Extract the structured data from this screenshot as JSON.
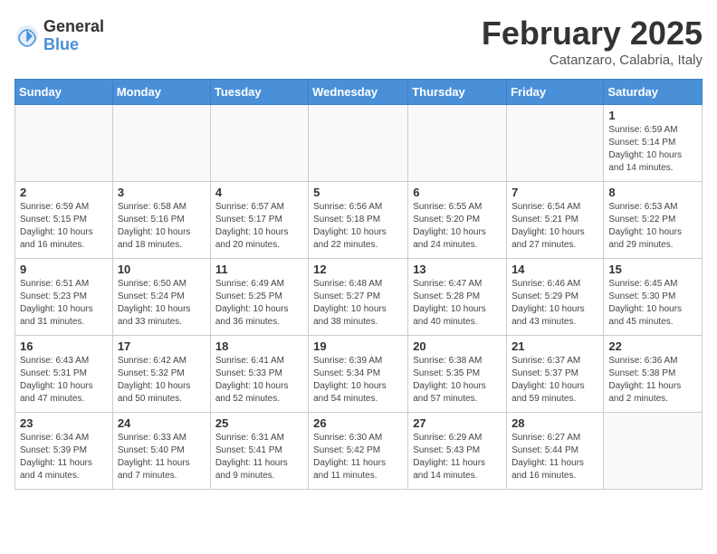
{
  "logo": {
    "general": "General",
    "blue": "Blue"
  },
  "title": "February 2025",
  "location": "Catanzaro, Calabria, Italy",
  "days_of_week": [
    "Sunday",
    "Monday",
    "Tuesday",
    "Wednesday",
    "Thursday",
    "Friday",
    "Saturday"
  ],
  "weeks": [
    [
      {
        "day": "",
        "info": ""
      },
      {
        "day": "",
        "info": ""
      },
      {
        "day": "",
        "info": ""
      },
      {
        "day": "",
        "info": ""
      },
      {
        "day": "",
        "info": ""
      },
      {
        "day": "",
        "info": ""
      },
      {
        "day": "1",
        "info": "Sunrise: 6:59 AM\nSunset: 5:14 PM\nDaylight: 10 hours and 14 minutes."
      }
    ],
    [
      {
        "day": "2",
        "info": "Sunrise: 6:59 AM\nSunset: 5:15 PM\nDaylight: 10 hours and 16 minutes."
      },
      {
        "day": "3",
        "info": "Sunrise: 6:58 AM\nSunset: 5:16 PM\nDaylight: 10 hours and 18 minutes."
      },
      {
        "day": "4",
        "info": "Sunrise: 6:57 AM\nSunset: 5:17 PM\nDaylight: 10 hours and 20 minutes."
      },
      {
        "day": "5",
        "info": "Sunrise: 6:56 AM\nSunset: 5:18 PM\nDaylight: 10 hours and 22 minutes."
      },
      {
        "day": "6",
        "info": "Sunrise: 6:55 AM\nSunset: 5:20 PM\nDaylight: 10 hours and 24 minutes."
      },
      {
        "day": "7",
        "info": "Sunrise: 6:54 AM\nSunset: 5:21 PM\nDaylight: 10 hours and 27 minutes."
      },
      {
        "day": "8",
        "info": "Sunrise: 6:53 AM\nSunset: 5:22 PM\nDaylight: 10 hours and 29 minutes."
      }
    ],
    [
      {
        "day": "9",
        "info": "Sunrise: 6:51 AM\nSunset: 5:23 PM\nDaylight: 10 hours and 31 minutes."
      },
      {
        "day": "10",
        "info": "Sunrise: 6:50 AM\nSunset: 5:24 PM\nDaylight: 10 hours and 33 minutes."
      },
      {
        "day": "11",
        "info": "Sunrise: 6:49 AM\nSunset: 5:25 PM\nDaylight: 10 hours and 36 minutes."
      },
      {
        "day": "12",
        "info": "Sunrise: 6:48 AM\nSunset: 5:27 PM\nDaylight: 10 hours and 38 minutes."
      },
      {
        "day": "13",
        "info": "Sunrise: 6:47 AM\nSunset: 5:28 PM\nDaylight: 10 hours and 40 minutes."
      },
      {
        "day": "14",
        "info": "Sunrise: 6:46 AM\nSunset: 5:29 PM\nDaylight: 10 hours and 43 minutes."
      },
      {
        "day": "15",
        "info": "Sunrise: 6:45 AM\nSunset: 5:30 PM\nDaylight: 10 hours and 45 minutes."
      }
    ],
    [
      {
        "day": "16",
        "info": "Sunrise: 6:43 AM\nSunset: 5:31 PM\nDaylight: 10 hours and 47 minutes."
      },
      {
        "day": "17",
        "info": "Sunrise: 6:42 AM\nSunset: 5:32 PM\nDaylight: 10 hours and 50 minutes."
      },
      {
        "day": "18",
        "info": "Sunrise: 6:41 AM\nSunset: 5:33 PM\nDaylight: 10 hours and 52 minutes."
      },
      {
        "day": "19",
        "info": "Sunrise: 6:39 AM\nSunset: 5:34 PM\nDaylight: 10 hours and 54 minutes."
      },
      {
        "day": "20",
        "info": "Sunrise: 6:38 AM\nSunset: 5:35 PM\nDaylight: 10 hours and 57 minutes."
      },
      {
        "day": "21",
        "info": "Sunrise: 6:37 AM\nSunset: 5:37 PM\nDaylight: 10 hours and 59 minutes."
      },
      {
        "day": "22",
        "info": "Sunrise: 6:36 AM\nSunset: 5:38 PM\nDaylight: 11 hours and 2 minutes."
      }
    ],
    [
      {
        "day": "23",
        "info": "Sunrise: 6:34 AM\nSunset: 5:39 PM\nDaylight: 11 hours and 4 minutes."
      },
      {
        "day": "24",
        "info": "Sunrise: 6:33 AM\nSunset: 5:40 PM\nDaylight: 11 hours and 7 minutes."
      },
      {
        "day": "25",
        "info": "Sunrise: 6:31 AM\nSunset: 5:41 PM\nDaylight: 11 hours and 9 minutes."
      },
      {
        "day": "26",
        "info": "Sunrise: 6:30 AM\nSunset: 5:42 PM\nDaylight: 11 hours and 11 minutes."
      },
      {
        "day": "27",
        "info": "Sunrise: 6:29 AM\nSunset: 5:43 PM\nDaylight: 11 hours and 14 minutes."
      },
      {
        "day": "28",
        "info": "Sunrise: 6:27 AM\nSunset: 5:44 PM\nDaylight: 11 hours and 16 minutes."
      },
      {
        "day": "",
        "info": ""
      }
    ]
  ]
}
